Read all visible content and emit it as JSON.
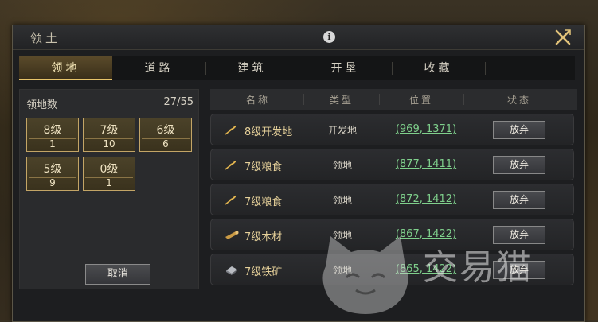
{
  "window": {
    "title": "领土"
  },
  "tabs": [
    {
      "label": "领地"
    },
    {
      "label": "道路"
    },
    {
      "label": "建筑"
    },
    {
      "label": "开垦"
    },
    {
      "label": "收藏"
    }
  ],
  "territory": {
    "count_label": "领地数",
    "count_value": "27/55",
    "levels": [
      {
        "name": "8级",
        "count": "1"
      },
      {
        "name": "7级",
        "count": "10"
      },
      {
        "name": "6级",
        "count": "6"
      },
      {
        "name": "5级",
        "count": "9"
      },
      {
        "name": "0级",
        "count": "1"
      }
    ],
    "cancel_label": "取消"
  },
  "table": {
    "headers": [
      "名称",
      "类型",
      "位置",
      "状态"
    ],
    "rows": [
      {
        "icon": "wheat-icon",
        "name": "8级开发地",
        "type": "开发地",
        "position": "(969, 1371)",
        "action": "放弃"
      },
      {
        "icon": "wheat-icon",
        "name": "7级粮食",
        "type": "领地",
        "position": "(877, 1411)",
        "action": "放弃"
      },
      {
        "icon": "wheat-icon",
        "name": "7级粮食",
        "type": "领地",
        "position": "(872, 1412)",
        "action": "放弃"
      },
      {
        "icon": "wood-icon",
        "name": "7级木材",
        "type": "领地",
        "position": "(867, 1422)",
        "action": "放弃"
      },
      {
        "icon": "iron-icon",
        "name": "7级铁矿",
        "type": "领地",
        "position": "(865, 1422)",
        "action": "放弃"
      }
    ]
  },
  "watermark": {
    "text": "交易猫"
  }
}
